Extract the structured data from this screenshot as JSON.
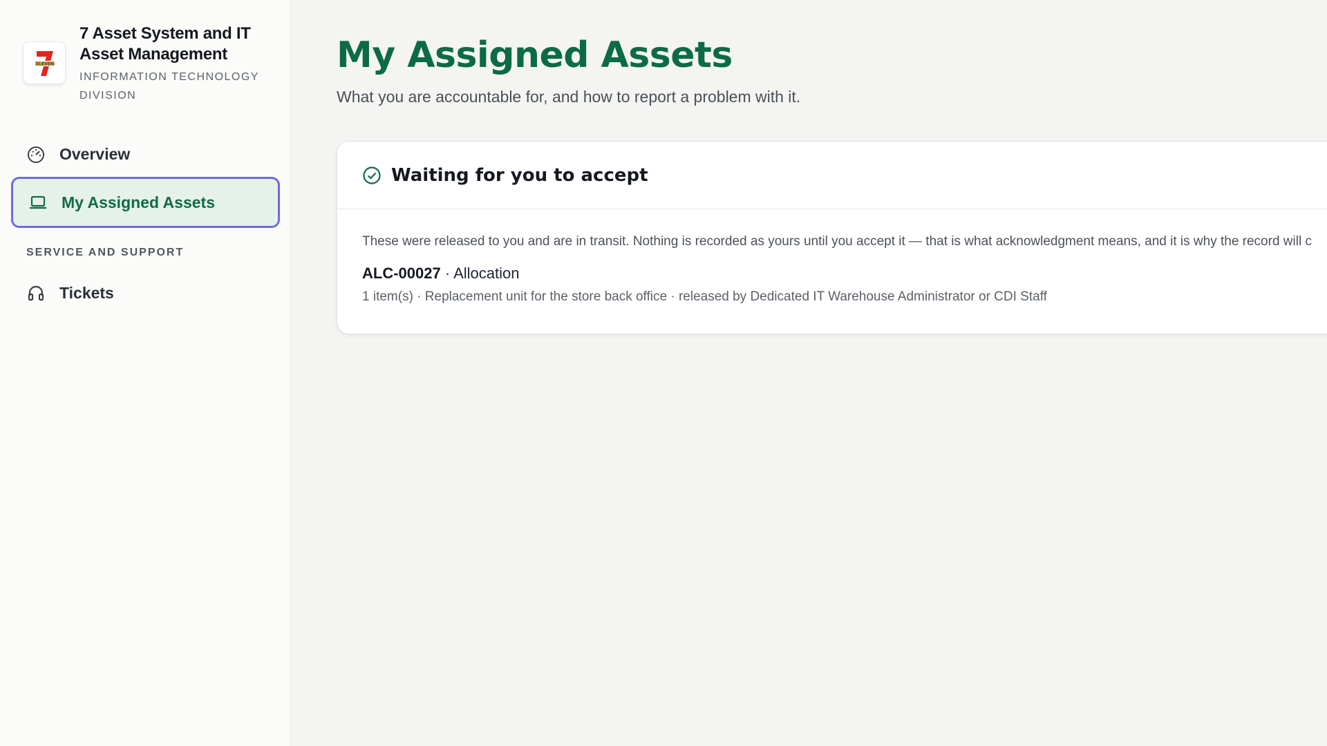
{
  "brand": {
    "title": "7 Asset System and IT Asset Management",
    "subtitle": "INFORMATION TECHNOLOGY DIVISION",
    "logo_icon": "seven-eleven-logo-icon"
  },
  "sidebar": {
    "items": [
      {
        "label": "Overview",
        "icon": "gauge-icon",
        "active": false
      },
      {
        "label": "My Assigned Assets",
        "icon": "laptop-icon",
        "active": true
      }
    ],
    "section_label": "SERVICE AND SUPPORT",
    "section_items": [
      {
        "label": "Tickets",
        "icon": "headset-icon",
        "active": false
      }
    ]
  },
  "main": {
    "title": "My Assigned Assets",
    "subtitle": "What you are accountable for, and how to report a problem with it.",
    "card": {
      "title": "Waiting for you to accept",
      "icon": "check-circle-icon",
      "note": "These were released to you and are in transit. Nothing is recorded as yours until you accept it — that is what acknowledgment means, and it is why the record will c",
      "allocation": {
        "id": "ALC-00027",
        "separator": " · ",
        "type": "Allocation",
        "meta": "1 item(s) · Replacement unit for the store back office · released by Dedicated IT Warehouse Administrator or CDI Staff"
      }
    }
  },
  "colors": {
    "accent_green": "#0b6b45",
    "active_bg": "#e6f1ec",
    "active_border": "#6c6ce0",
    "brand_red": "#e1261c",
    "brand_orange": "#f58220"
  }
}
